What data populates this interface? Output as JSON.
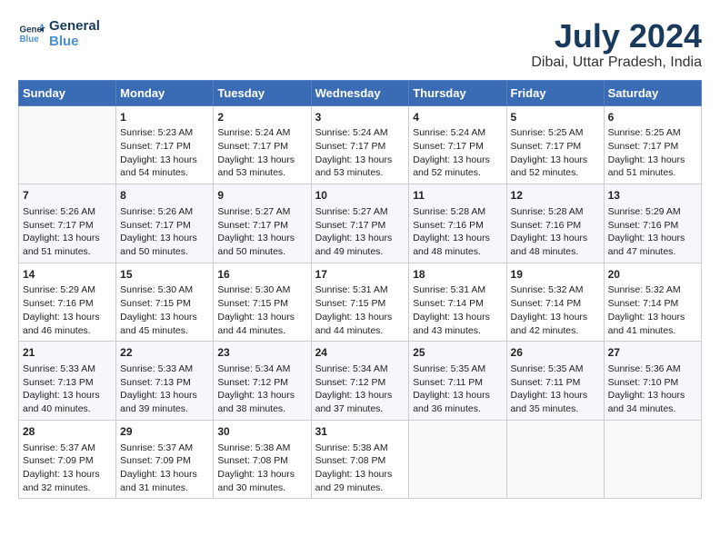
{
  "header": {
    "logo_line1": "General",
    "logo_line2": "Blue",
    "month_title": "July 2024",
    "location": "Dibai, Uttar Pradesh, India"
  },
  "weekdays": [
    "Sunday",
    "Monday",
    "Tuesday",
    "Wednesday",
    "Thursday",
    "Friday",
    "Saturday"
  ],
  "weeks": [
    [
      {
        "day": "",
        "sunrise": "",
        "sunset": "",
        "daylight": ""
      },
      {
        "day": "1",
        "sunrise": "Sunrise: 5:23 AM",
        "sunset": "Sunset: 7:17 PM",
        "daylight": "Daylight: 13 hours and 54 minutes."
      },
      {
        "day": "2",
        "sunrise": "Sunrise: 5:24 AM",
        "sunset": "Sunset: 7:17 PM",
        "daylight": "Daylight: 13 hours and 53 minutes."
      },
      {
        "day": "3",
        "sunrise": "Sunrise: 5:24 AM",
        "sunset": "Sunset: 7:17 PM",
        "daylight": "Daylight: 13 hours and 53 minutes."
      },
      {
        "day": "4",
        "sunrise": "Sunrise: 5:24 AM",
        "sunset": "Sunset: 7:17 PM",
        "daylight": "Daylight: 13 hours and 52 minutes."
      },
      {
        "day": "5",
        "sunrise": "Sunrise: 5:25 AM",
        "sunset": "Sunset: 7:17 PM",
        "daylight": "Daylight: 13 hours and 52 minutes."
      },
      {
        "day": "6",
        "sunrise": "Sunrise: 5:25 AM",
        "sunset": "Sunset: 7:17 PM",
        "daylight": "Daylight: 13 hours and 51 minutes."
      }
    ],
    [
      {
        "day": "7",
        "sunrise": "Sunrise: 5:26 AM",
        "sunset": "Sunset: 7:17 PM",
        "daylight": "Daylight: 13 hours and 51 minutes."
      },
      {
        "day": "8",
        "sunrise": "Sunrise: 5:26 AM",
        "sunset": "Sunset: 7:17 PM",
        "daylight": "Daylight: 13 hours and 50 minutes."
      },
      {
        "day": "9",
        "sunrise": "Sunrise: 5:27 AM",
        "sunset": "Sunset: 7:17 PM",
        "daylight": "Daylight: 13 hours and 50 minutes."
      },
      {
        "day": "10",
        "sunrise": "Sunrise: 5:27 AM",
        "sunset": "Sunset: 7:17 PM",
        "daylight": "Daylight: 13 hours and 49 minutes."
      },
      {
        "day": "11",
        "sunrise": "Sunrise: 5:28 AM",
        "sunset": "Sunset: 7:16 PM",
        "daylight": "Daylight: 13 hours and 48 minutes."
      },
      {
        "day": "12",
        "sunrise": "Sunrise: 5:28 AM",
        "sunset": "Sunset: 7:16 PM",
        "daylight": "Daylight: 13 hours and 48 minutes."
      },
      {
        "day": "13",
        "sunrise": "Sunrise: 5:29 AM",
        "sunset": "Sunset: 7:16 PM",
        "daylight": "Daylight: 13 hours and 47 minutes."
      }
    ],
    [
      {
        "day": "14",
        "sunrise": "Sunrise: 5:29 AM",
        "sunset": "Sunset: 7:16 PM",
        "daylight": "Daylight: 13 hours and 46 minutes."
      },
      {
        "day": "15",
        "sunrise": "Sunrise: 5:30 AM",
        "sunset": "Sunset: 7:15 PM",
        "daylight": "Daylight: 13 hours and 45 minutes."
      },
      {
        "day": "16",
        "sunrise": "Sunrise: 5:30 AM",
        "sunset": "Sunset: 7:15 PM",
        "daylight": "Daylight: 13 hours and 44 minutes."
      },
      {
        "day": "17",
        "sunrise": "Sunrise: 5:31 AM",
        "sunset": "Sunset: 7:15 PM",
        "daylight": "Daylight: 13 hours and 44 minutes."
      },
      {
        "day": "18",
        "sunrise": "Sunrise: 5:31 AM",
        "sunset": "Sunset: 7:14 PM",
        "daylight": "Daylight: 13 hours and 43 minutes."
      },
      {
        "day": "19",
        "sunrise": "Sunrise: 5:32 AM",
        "sunset": "Sunset: 7:14 PM",
        "daylight": "Daylight: 13 hours and 42 minutes."
      },
      {
        "day": "20",
        "sunrise": "Sunrise: 5:32 AM",
        "sunset": "Sunset: 7:14 PM",
        "daylight": "Daylight: 13 hours and 41 minutes."
      }
    ],
    [
      {
        "day": "21",
        "sunrise": "Sunrise: 5:33 AM",
        "sunset": "Sunset: 7:13 PM",
        "daylight": "Daylight: 13 hours and 40 minutes."
      },
      {
        "day": "22",
        "sunrise": "Sunrise: 5:33 AM",
        "sunset": "Sunset: 7:13 PM",
        "daylight": "Daylight: 13 hours and 39 minutes."
      },
      {
        "day": "23",
        "sunrise": "Sunrise: 5:34 AM",
        "sunset": "Sunset: 7:12 PM",
        "daylight": "Daylight: 13 hours and 38 minutes."
      },
      {
        "day": "24",
        "sunrise": "Sunrise: 5:34 AM",
        "sunset": "Sunset: 7:12 PM",
        "daylight": "Daylight: 13 hours and 37 minutes."
      },
      {
        "day": "25",
        "sunrise": "Sunrise: 5:35 AM",
        "sunset": "Sunset: 7:11 PM",
        "daylight": "Daylight: 13 hours and 36 minutes."
      },
      {
        "day": "26",
        "sunrise": "Sunrise: 5:35 AM",
        "sunset": "Sunset: 7:11 PM",
        "daylight": "Daylight: 13 hours and 35 minutes."
      },
      {
        "day": "27",
        "sunrise": "Sunrise: 5:36 AM",
        "sunset": "Sunset: 7:10 PM",
        "daylight": "Daylight: 13 hours and 34 minutes."
      }
    ],
    [
      {
        "day": "28",
        "sunrise": "Sunrise: 5:37 AM",
        "sunset": "Sunset: 7:09 PM",
        "daylight": "Daylight: 13 hours and 32 minutes."
      },
      {
        "day": "29",
        "sunrise": "Sunrise: 5:37 AM",
        "sunset": "Sunset: 7:09 PM",
        "daylight": "Daylight: 13 hours and 31 minutes."
      },
      {
        "day": "30",
        "sunrise": "Sunrise: 5:38 AM",
        "sunset": "Sunset: 7:08 PM",
        "daylight": "Daylight: 13 hours and 30 minutes."
      },
      {
        "day": "31",
        "sunrise": "Sunrise: 5:38 AM",
        "sunset": "Sunset: 7:08 PM",
        "daylight": "Daylight: 13 hours and 29 minutes."
      },
      {
        "day": "",
        "sunrise": "",
        "sunset": "",
        "daylight": ""
      },
      {
        "day": "",
        "sunrise": "",
        "sunset": "",
        "daylight": ""
      },
      {
        "day": "",
        "sunrise": "",
        "sunset": "",
        "daylight": ""
      }
    ]
  ]
}
